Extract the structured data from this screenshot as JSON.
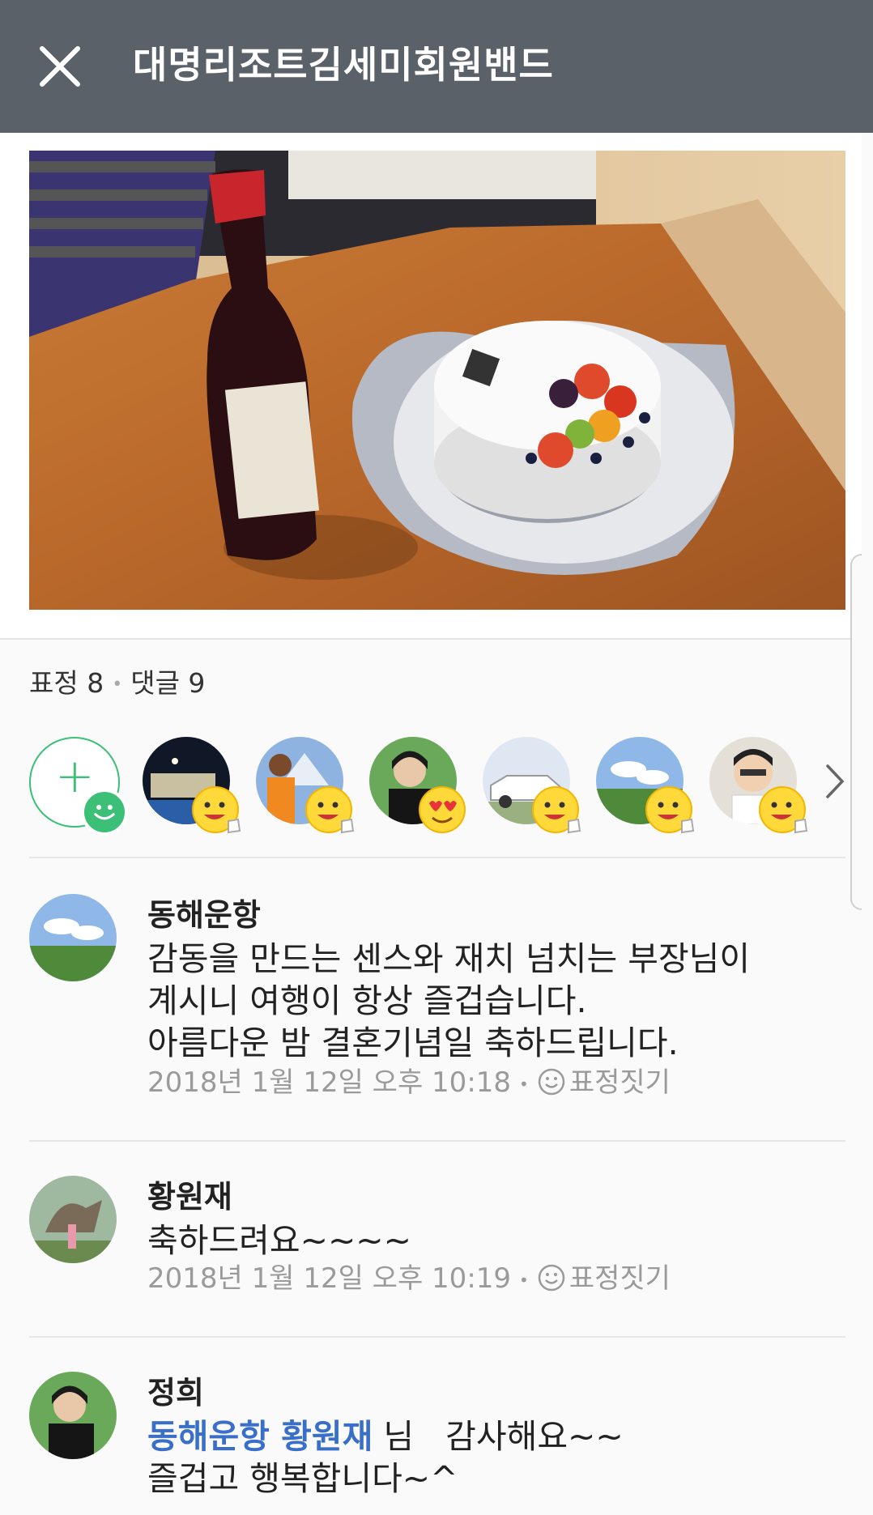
{
  "header": {
    "title": "대명리조트김세미회원밴드",
    "close_icon": "close-icon"
  },
  "post": {
    "photo_icon": "photo-wine-and-cake"
  },
  "counts": {
    "reactions_label": "표정 8",
    "comments_label": "댓글 9"
  },
  "reactions": {
    "add_icon": "add-reaction-icon",
    "items": [
      {
        "avatar": "resort-night-photo",
        "emoji": "thumbs-up-emoji"
      },
      {
        "avatar": "man-mountain-photo",
        "emoji": "thumbs-up-emoji"
      },
      {
        "avatar": "woman-photo",
        "emoji": "heart-eyes-emoji"
      },
      {
        "avatar": "white-car-photo",
        "emoji": "thumbs-up-emoji"
      },
      {
        "avatar": "green-field-sky-photo",
        "emoji": "thumbs-up-emoji"
      },
      {
        "avatar": "cartoon-man-photo",
        "emoji": "thumbs-up-emoji"
      }
    ],
    "more_icon": "chevron-right-icon"
  },
  "comments": [
    {
      "name": "동해운항",
      "lines": [
        "감동을 만드는 센스와 재치 넘치는 부장님이",
        "계시니 여행이 항상 즐겁습니다.",
        "아름다운 밤 결혼기념일 축하드립니다."
      ],
      "time": "2018년 1월 12일 오후 10:18",
      "react_label": "표정짓기"
    },
    {
      "name": "황원재",
      "lines": [
        "축하드려요~~~~"
      ],
      "time": "2018년 1월 12일 오후 10:19",
      "react_label": "표정짓기"
    },
    {
      "name": "정희",
      "mention": "동해운항 황원재",
      "mention_suffix": " 님   감사해요~~",
      "lines": [
        "즐겁고 행복합니다~^"
      ]
    }
  ],
  "colors": {
    "header_bg": "#5b6169",
    "accent_green": "#3cbf77",
    "mention_blue": "#3a6fc9"
  }
}
